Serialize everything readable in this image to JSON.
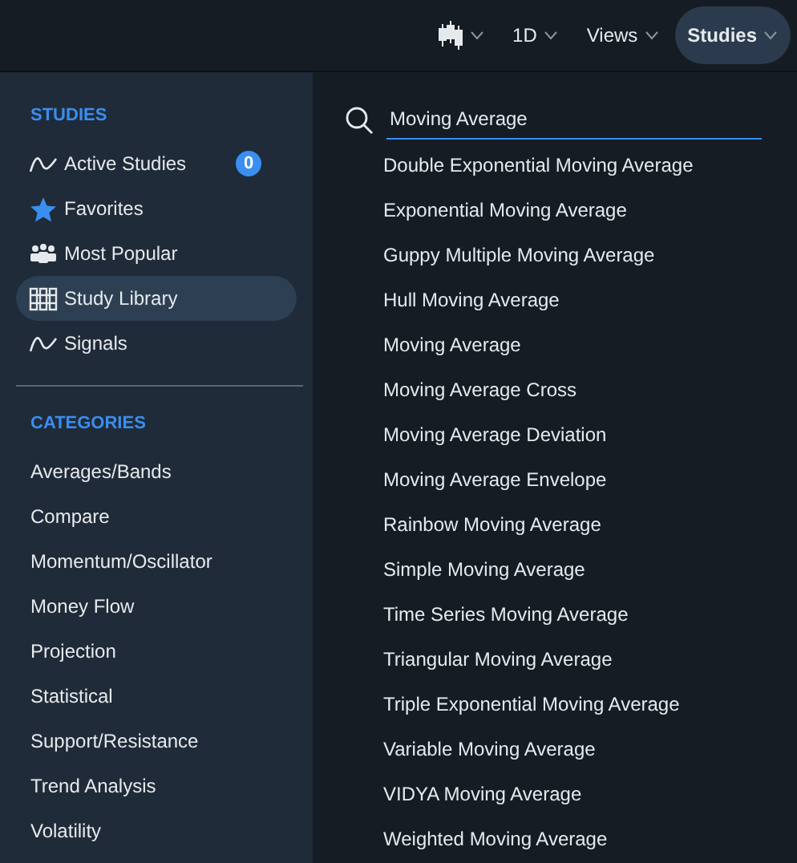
{
  "toolbar": [
    {
      "kind": "chart-type",
      "selected": false
    },
    {
      "kind": "text",
      "label": "1D",
      "selected": false
    },
    {
      "kind": "text",
      "label": "Views",
      "selected": false
    },
    {
      "kind": "text",
      "label": "Studies",
      "selected": true
    }
  ],
  "sidebar": {
    "studies_heading": "STUDIES",
    "items": [
      {
        "kind": "line",
        "label": "Active Studies",
        "badge": "0",
        "selected": false
      },
      {
        "kind": "star",
        "label": "Favorites",
        "selected": false
      },
      {
        "kind": "people",
        "label": "Most Popular",
        "selected": false
      },
      {
        "kind": "library",
        "label": "Study Library",
        "selected": true
      },
      {
        "kind": "line",
        "label": "Signals",
        "selected": false
      }
    ],
    "categories_heading": "CATEGORIES",
    "categories": [
      "Averages/Bands",
      "Compare",
      "Momentum/Oscillator",
      "Money Flow",
      "Projection",
      "Statistical",
      "Support/Resistance",
      "Trend Analysis",
      "Volatility"
    ]
  },
  "search": {
    "value": "Moving Average"
  },
  "results": [
    "Double Exponential Moving Average",
    "Exponential Moving Average",
    "Guppy Multiple Moving Average",
    "Hull Moving Average",
    "Moving Average",
    "Moving Average Cross",
    "Moving Average Deviation",
    "Moving Average Envelope",
    "Rainbow Moving Average",
    "Simple Moving Average",
    "Time Series Moving Average",
    "Triangular Moving Average",
    "Triple Exponential Moving Average",
    "Variable Moving Average",
    "VIDYA Moving Average",
    "Weighted Moving Average"
  ]
}
